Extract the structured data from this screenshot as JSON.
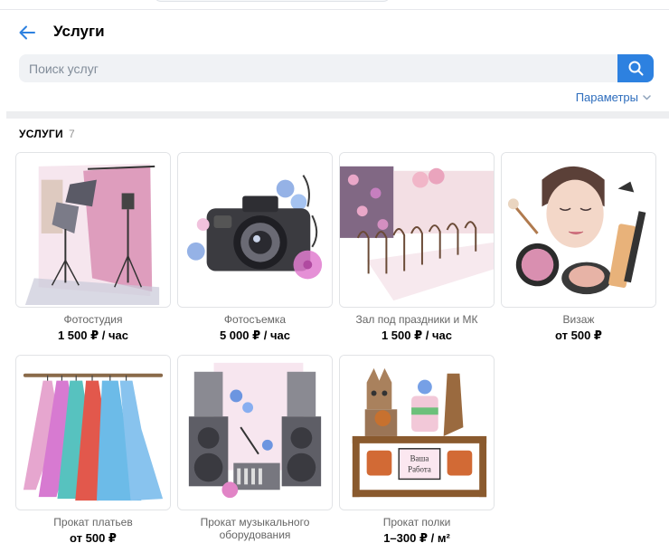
{
  "header": {
    "title": "Услуги"
  },
  "search": {
    "placeholder": "Поиск услуг"
  },
  "filters": {
    "params_label": "Параметры"
  },
  "section": {
    "title": "УСЛУГИ",
    "count": "7"
  },
  "services": [
    {
      "name": "Фотостудия",
      "price": "1 500 ₽ / час",
      "image": "photo-studio-illustration"
    },
    {
      "name": "Фотосъемка",
      "price": "5 000 ₽ / час",
      "image": "camera-illustration"
    },
    {
      "name": "Зал под праздники и МК",
      "price": "1 500 ₽ / час",
      "image": "hall-illustration"
    },
    {
      "name": "Визаж",
      "price": "от 500 ₽",
      "image": "makeup-illustration"
    },
    {
      "name": "Прокат платьев",
      "price": "от 500 ₽",
      "image": "dresses-illustration"
    },
    {
      "name": "Прокат музыкального оборудования",
      "price": "",
      "image": "speakers-illustration"
    },
    {
      "name": "Прокат полки",
      "price": "1–300 ₽ / м²",
      "image": "shelf-illustration"
    }
  ],
  "shelf_sign_lines": [
    "Ваша",
    "Работа"
  ],
  "colors": {
    "accent": "#2d81e0",
    "link": "#2d6dbd",
    "input_bg": "#f0f2f5",
    "separator": "#edeef0"
  }
}
